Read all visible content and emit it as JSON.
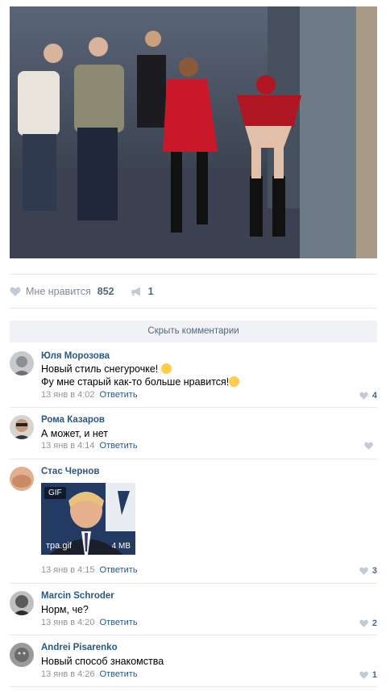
{
  "post": {
    "likes_label": "Мне нравится",
    "likes_count": "852",
    "shares_count": "1",
    "hide_comments": "Скрыть комментарии"
  },
  "comments": [
    {
      "author": "Юля Морозова",
      "lines": [
        "Новый стиль снегурочке!",
        "Фу мне старый как-то больше нравится!"
      ],
      "time": "13 янв в 4:02",
      "reply": "Ответить",
      "likes": "4"
    },
    {
      "author": "Рома Казаров",
      "lines": [
        "А может, и нет"
      ],
      "time": "13 янв в 4:14",
      "reply": "Ответить",
      "likes": ""
    },
    {
      "author": "Стас Чернов",
      "gif": {
        "tag": "GIF",
        "name": "тра.gif",
        "size": "4 MB"
      },
      "time": "13 янв в 4:15",
      "reply": "Ответить",
      "likes": "3"
    },
    {
      "author": "Marcin Schroder",
      "lines": [
        "Норм, че?"
      ],
      "time": "13 янв в 4:20",
      "reply": "Ответить",
      "likes": "2"
    },
    {
      "author": "Andrei Pisarenko",
      "lines": [
        "Новый способ знакомства"
      ],
      "time": "13 янв в 4:26",
      "reply": "Ответить",
      "likes": "1"
    }
  ],
  "colors": {
    "link": "#2a5885",
    "meta": "#939393",
    "separator": "#e7e8ec",
    "button_bg": "#f0f2f5"
  },
  "icons": {
    "like": "heart-icon",
    "share": "megaphone-icon",
    "emoji": "smiley-icon"
  }
}
